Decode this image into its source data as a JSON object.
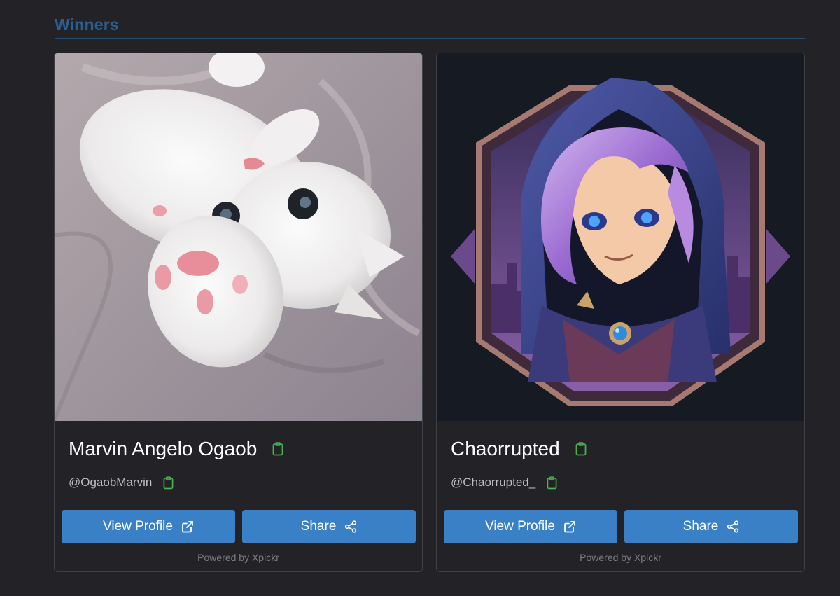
{
  "section": {
    "title": "Winners"
  },
  "winners": [
    {
      "name": "Marvin Angelo Ogaob",
      "handle": "@OgaobMarvin",
      "view_label": "View Profile",
      "share_label": "Share",
      "powered": "Powered by Xpickr",
      "avatar": "white-cat-photo"
    },
    {
      "name": "Chaorrupted",
      "handle": "@Chaorrupted_",
      "view_label": "View Profile",
      "share_label": "Share",
      "powered": "Powered by Xpickr",
      "avatar": "hooded-mage-illustration"
    }
  ],
  "icons": {
    "copy": "clipboard-icon",
    "external": "external-link-icon",
    "share": "share-nodes-icon"
  },
  "colors": {
    "background": "#232327",
    "accent_title": "#2b5f8f",
    "button": "#3a80c6",
    "copy_icon": "#4caf50"
  }
}
